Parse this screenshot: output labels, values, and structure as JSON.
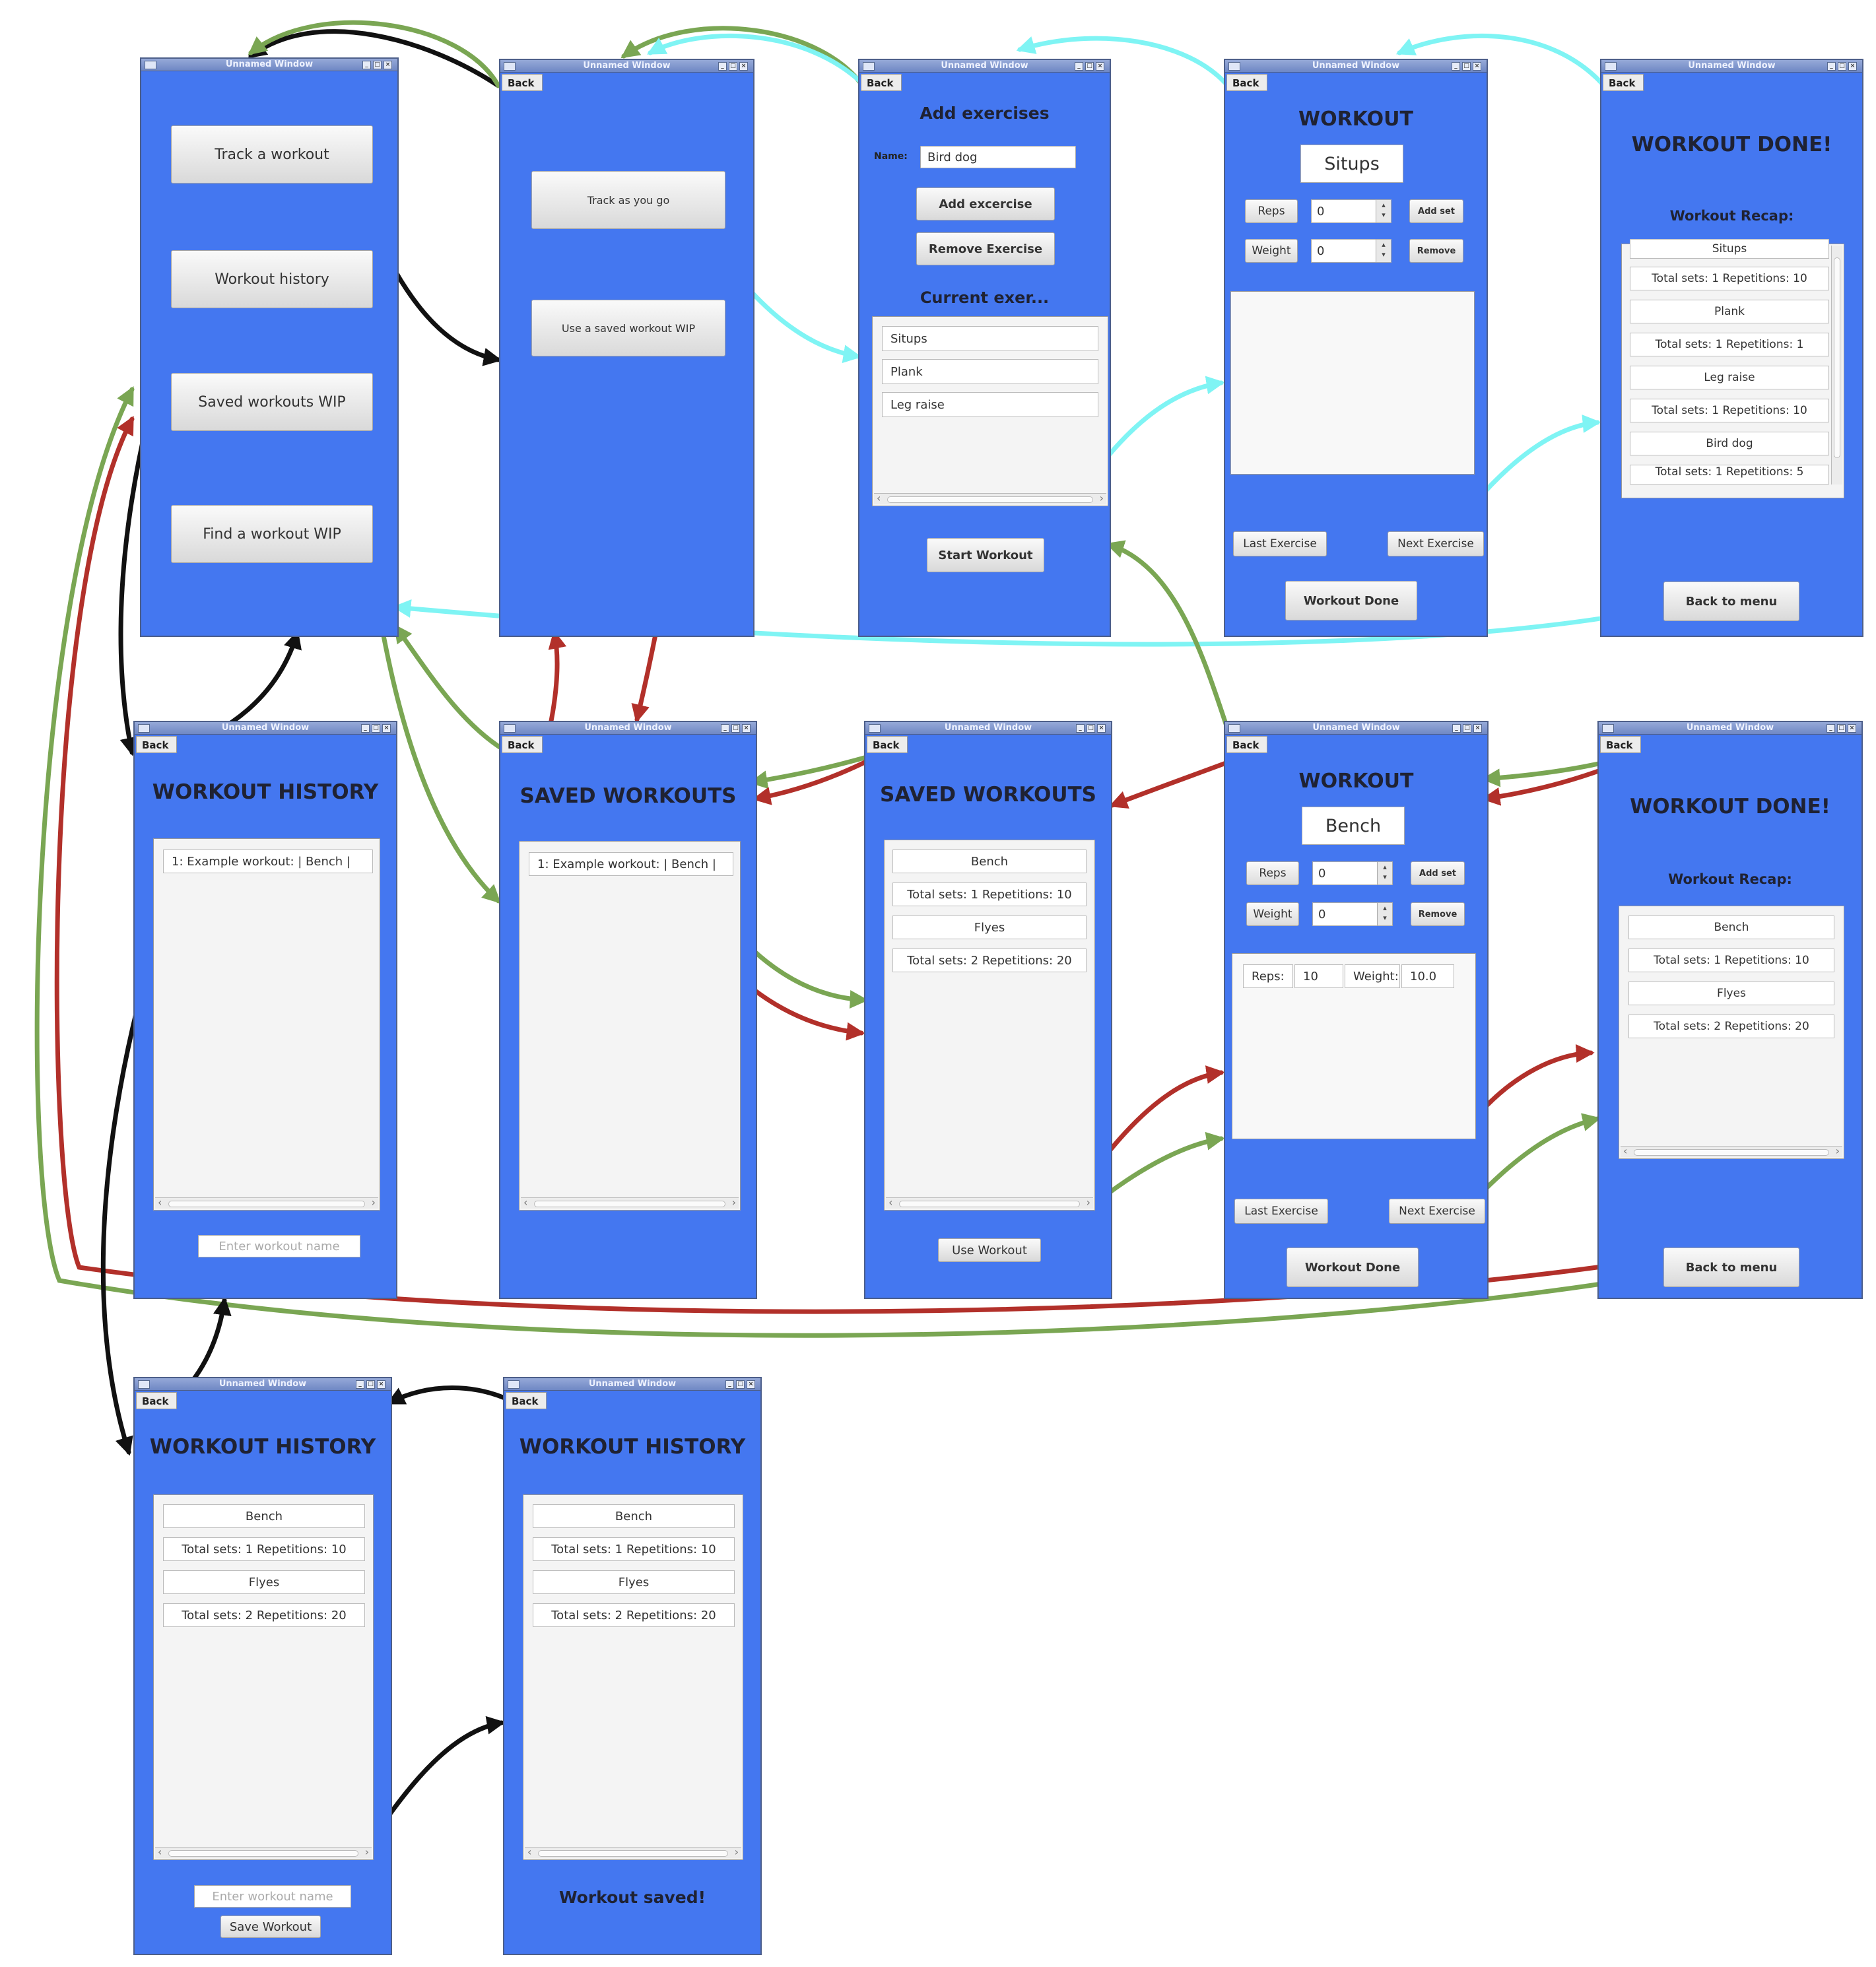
{
  "window_title": "Unnamed Window",
  "back_label": "Back",
  "main_menu": {
    "buttons": [
      "Track a workout",
      "Workout history",
      "Saved workouts WIP",
      "Find a workout WIP"
    ]
  },
  "track_menu": {
    "buttons": [
      "Track as you go",
      "Use a saved workout WIP"
    ]
  },
  "add_exercises": {
    "title": "Add exercises",
    "name_label": "Name:",
    "name_value": "Bird dog",
    "add_button": "Add excercise",
    "remove_button": "Remove Exercise",
    "current_label": "Current exer...",
    "items": [
      "Situps",
      "Plank",
      "Leg raise"
    ],
    "start_button": "Start Workout"
  },
  "workout_1": {
    "title": "WORKOUT",
    "exercise": "Situps",
    "reps_label": "Reps",
    "reps_value": "0",
    "weight_label": "Weight",
    "weight_value": "0",
    "add_set": "Add set",
    "remove": "Remove",
    "last_exercise": "Last Exercise",
    "next_exercise": "Next Exercise",
    "done": "Workout Done"
  },
  "done_1": {
    "title": "WORKOUT DONE!",
    "recap_label": "Workout Recap:",
    "rows": [
      "Situps",
      "Total sets: 1  Repetitions: 10",
      "Plank",
      "Total sets: 1  Repetitions: 1",
      "Leg raise",
      "Total sets: 1  Repetitions: 10",
      "Bird dog",
      "Total sets: 1  Repetitions: 5"
    ],
    "menu_button": "Back to menu"
  },
  "history_1": {
    "title": "WORKOUT HISTORY",
    "item": "1: Example workout:  | Bench |",
    "placeholder": "Enter workout name"
  },
  "saved_1": {
    "title": "SAVED WORKOUTS",
    "item": "1: Example workout:  | Bench |"
  },
  "saved_2": {
    "title": "SAVED WORKOUTS",
    "rows": [
      "Bench",
      "Total sets: 1  Repetitions: 10",
      "Flyes",
      "Total sets: 2  Repetitions: 20"
    ],
    "use_button": "Use Workout"
  },
  "workout_2": {
    "title": "WORKOUT",
    "exercise": "Bench",
    "reps_label": "Reps",
    "reps_value": "0",
    "weight_label": "Weight",
    "weight_value": "0",
    "add_set": "Add set",
    "remove": "Remove",
    "set_reps_label": "Reps:",
    "set_reps_value": "10",
    "set_weight_label": "Weight:",
    "set_weight_value": "10.0",
    "last_exercise": "Last Exercise",
    "next_exercise": "Next Exercise",
    "done": "Workout Done"
  },
  "done_2": {
    "title": "WORKOUT DONE!",
    "recap_label": "Workout Recap:",
    "rows": [
      "Bench",
      "Total sets: 1  Repetitions: 10",
      "Flyes",
      "Total sets: 2  Repetitions: 20"
    ],
    "menu_button": "Back to menu"
  },
  "history_2": {
    "title": "WORKOUT HISTORY",
    "rows": [
      "Bench",
      "Total sets: 1  Repetitions: 10",
      "Flyes",
      "Total sets: 2  Repetitions: 20"
    ],
    "placeholder": "Enter workout name",
    "save_button": "Save Workout"
  },
  "history_3": {
    "title": "WORKOUT HISTORY",
    "rows": [
      "Bench",
      "Total sets: 1  Repetitions: 10",
      "Flyes",
      "Total sets: 2  Repetitions: 20"
    ],
    "saved_msg": "Workout saved!"
  },
  "colors": {
    "window_bg": "#4477f0",
    "arrow_black": "#111111",
    "arrow_green": "#7aa653",
    "arrow_cyan": "#7ff4f4",
    "arrow_red": "#b2302a"
  }
}
